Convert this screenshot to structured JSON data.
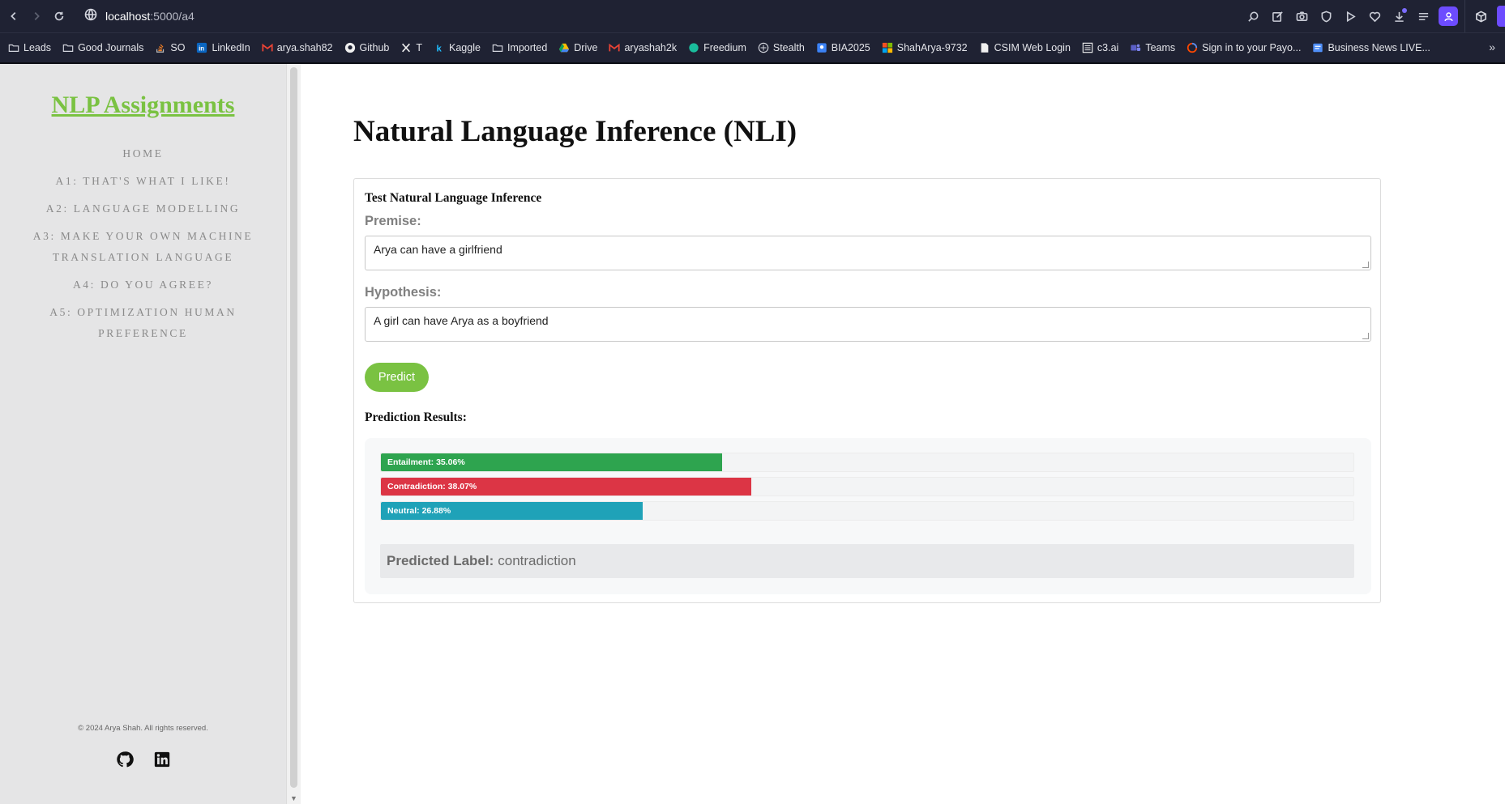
{
  "browser": {
    "url_host": "localhost",
    "url_path": ":5000/a4",
    "bookmarks": [
      {
        "label": "Leads",
        "icon": "folder-icon"
      },
      {
        "label": "Good Journals",
        "icon": "folder-icon"
      },
      {
        "label": "SO",
        "icon": "stackoverflow-icon"
      },
      {
        "label": "LinkedIn",
        "icon": "linkedin-icon"
      },
      {
        "label": "arya.shah82",
        "icon": "gmail-icon"
      },
      {
        "label": "Github",
        "icon": "github-icon"
      },
      {
        "label": "T",
        "icon": "x-icon"
      },
      {
        "label": "Kaggle",
        "icon": "kaggle-icon"
      },
      {
        "label": "Imported",
        "icon": "folder-icon"
      },
      {
        "label": "Drive",
        "icon": "drive-icon"
      },
      {
        "label": "aryashah2k",
        "icon": "gmail-icon"
      },
      {
        "label": "Freedium",
        "icon": "freedium-icon"
      },
      {
        "label": "Stealth",
        "icon": "stealth-icon"
      },
      {
        "label": "BIA2025",
        "icon": "bia-icon"
      },
      {
        "label": "ShahArya-9732",
        "icon": "microsoft-icon"
      },
      {
        "label": "CSIM Web Login",
        "icon": "document-icon"
      },
      {
        "label": "c3.ai",
        "icon": "c3-icon"
      },
      {
        "label": "Teams",
        "icon": "teams-icon"
      },
      {
        "label": "Sign in to your Payo...",
        "icon": "payoneer-icon"
      },
      {
        "label": "Business News LIVE...",
        "icon": "news-icon"
      }
    ]
  },
  "sidebar": {
    "brand": "NLP Assignments",
    "nav": [
      "HOME",
      "A1: THAT'S WHAT I LIKE!",
      "A2: LANGUAGE MODELLING",
      "A3: MAKE YOUR OWN MACHINE TRANSLATION LANGUAGE",
      "A4: DO YOU AGREE?",
      "A5: OPTIMIZATION HUMAN PREFERENCE"
    ],
    "footer": "© 2024 Arya Shah. All rights reserved."
  },
  "main": {
    "title": "Natural Language Inference (NLI)",
    "card_title": "Test Natural Language Inference",
    "premise_label": "Premise:",
    "premise_value": "Arya can have a girlfriend",
    "hypothesis_label": "Hypothesis:",
    "hypothesis_value": "A girl can have Arya as a boyfriend",
    "predict_label": "Predict",
    "results_title": "Prediction Results:",
    "results": [
      {
        "label": "Entailment: 35.06%",
        "value": 35.06,
        "color": "#2ea44f"
      },
      {
        "label": "Contradiction: 38.07%",
        "value": 38.07,
        "color": "#dc3545"
      },
      {
        "label": "Neutral: 26.88%",
        "value": 26.88,
        "color": "#1fa2b8"
      }
    ],
    "predicted_prefix": "Predicted Label:",
    "predicted_value": "contradiction"
  }
}
